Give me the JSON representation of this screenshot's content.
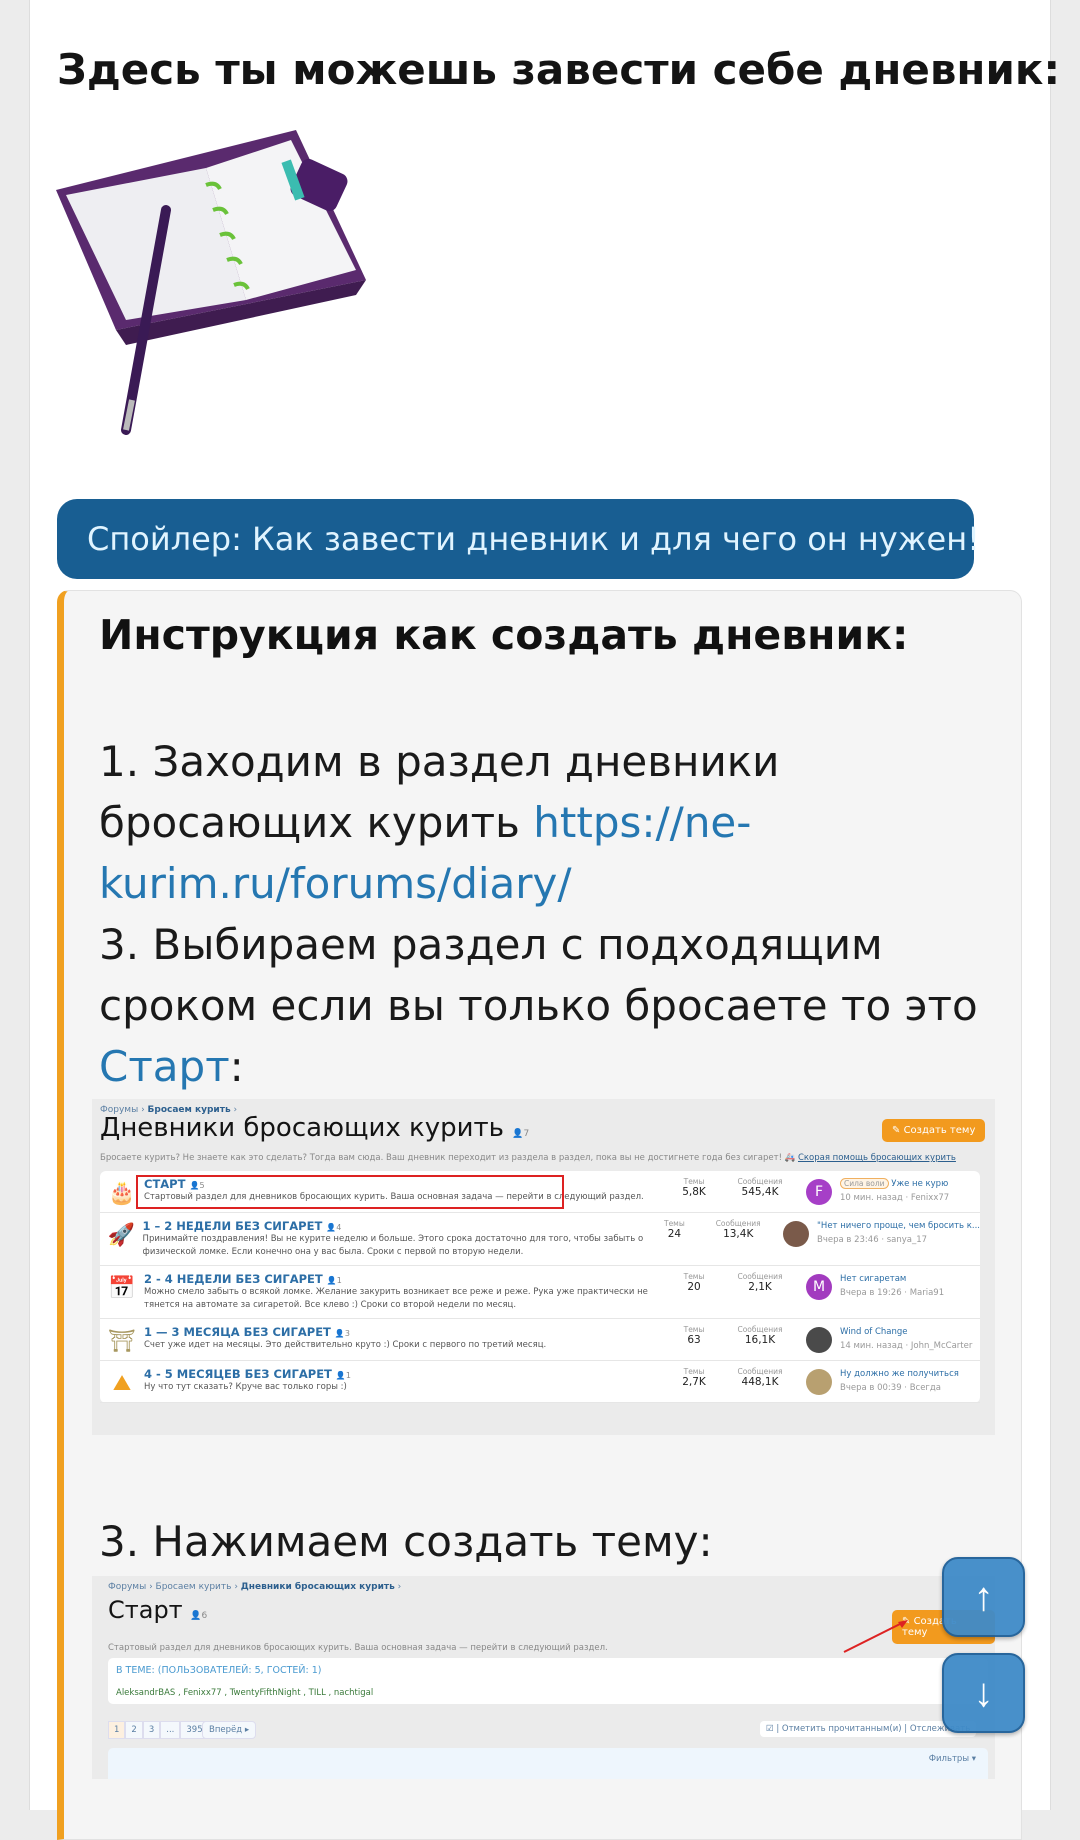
{
  "heading": "Здесь ты можешь завести себе дневник:",
  "spoiler_label": "Спойлер: Как завести дневник и для чего он нужен!",
  "quote": {
    "title": "Инструкция как создать дневник:",
    "step1_text": "1. Заходим в раздел дневники бросающих курить ",
    "step1_link": "https://ne-kurim.ru/forums/diary/",
    "step3_text": "3. Выбираем раздел с подходящим сроком если вы только бросаете то это ",
    "step3_link": "Старт",
    "step3_suffix": ":",
    "step4_text": "3. Нажимаем создать тему:"
  },
  "shot1": {
    "crumb1": "Форумы",
    "crumb2": "Бросаем курить",
    "title": "Дневники бросающих курить",
    "watchers": "7",
    "create_btn": "Создать тему",
    "desc": "Бросаете курить? Не знаете как это сделать? Тогда вам сюда. Ваш дневник переходит из раздела в раздел, пока вы не достигнете года без сигарет!",
    "help_link": "Скорая помощь бросающих курить",
    "threads_label": "Темы",
    "messages_label": "Сообщения",
    "rows": [
      {
        "icon": "cake-icon",
        "title": "СТАРТ",
        "count": "5",
        "desc": "Стартовый раздел для дневников бросающих курить. Ваша основная задача — перейти в следующий раздел.",
        "threads": "5,8K",
        "messages": "545,4K",
        "avatar": "F",
        "avatar_color": "#a63fc7",
        "tag": "Сила воли",
        "last_title": "Уже не курю",
        "last_meta": "10 мин. назад · Fenixx77"
      },
      {
        "icon": "rocket-icon",
        "title": "1 – 2 НЕДЕЛИ БЕЗ СИГАРЕТ",
        "count": "4",
        "desc": "Принимайте поздравления! Вы не курите неделю и больше. Этого срока достаточно для того, чтобы забыть о физической ломке. Если конечно она у вас была. Сроки с первой по вторую недели.",
        "threads": "24",
        "messages": "13,4K",
        "avatar": "",
        "avatar_color": "#7a5a4a",
        "last_title": "\"Нет ничего проще, чем бросить к...",
        "last_meta": "Вчера в 23:46 · sanya_17"
      },
      {
        "icon": "calendar-icon",
        "title": "2 - 4 НЕДЕЛИ БЕЗ СИГАРЕТ",
        "count": "1",
        "desc": "Можно смело забыть о всякой ломке. Желание закурить возникает все реже и реже. Рука уже практически не тянется на автомате за сигаретой. Все клево :) Сроки со второй недели по месяц.",
        "threads": "20",
        "messages": "2,1K",
        "avatar": "M",
        "avatar_color": "#a23bbf",
        "last_title": "Нет сигаретам",
        "last_meta": "Вчера в 19:26 · Maria91"
      },
      {
        "icon": "arch-icon",
        "title": "1 — 3 МЕСЯЦА БЕЗ СИГАРЕТ",
        "count": "3",
        "desc": "Счет уже идет на месяцы. Это действительно круто :) Сроки с первого по третий месяц.",
        "threads": "63",
        "messages": "16,1K",
        "avatar": "",
        "avatar_color": "#4a4a4a",
        "last_title": "Wind of Change",
        "last_meta": "14 мин. назад · John_McCarter"
      },
      {
        "icon": "mountain-icon",
        "title": "4 - 5 МЕСЯЦЕВ БЕЗ СИГАРЕТ",
        "count": "1",
        "desc": "Ну что тут сказать? Круче вас только горы :)",
        "threads": "2,7K",
        "messages": "448,1K",
        "avatar": "",
        "avatar_color": "#b8a070",
        "last_title": "Ну должно же получиться",
        "last_meta": "Вчера в 00:39 · Всегда"
      }
    ]
  },
  "shot2": {
    "crumb1": "Форумы",
    "crumb2": "Бросаем курить",
    "crumb3": "Дневники бросающих курить",
    "title": "Старт",
    "watchers": "6",
    "create_btn": "Создать тему",
    "desc": "Стартовый раздел для дневников бросающих курить. Ваша основная задача — перейти в следующий раздел.",
    "online_title": "В ТЕМЕ: (ПОЛЬЗОВАТЕЛЕЙ: 5, ГОСТЕЙ: 1)",
    "online_users": "AleksandrBAS , Fenixx77 , TwentyFifthNight , TILL , nachtigal",
    "pages": [
      "1",
      "2",
      "3",
      "...",
      "395"
    ],
    "next": "Вперёд ▸",
    "mark_read": "Отметить прочитанным(и)",
    "watch": "Отслеживать",
    "filters": "Фильтры ▾"
  },
  "fab": {
    "up": "↑",
    "down": "↓"
  }
}
